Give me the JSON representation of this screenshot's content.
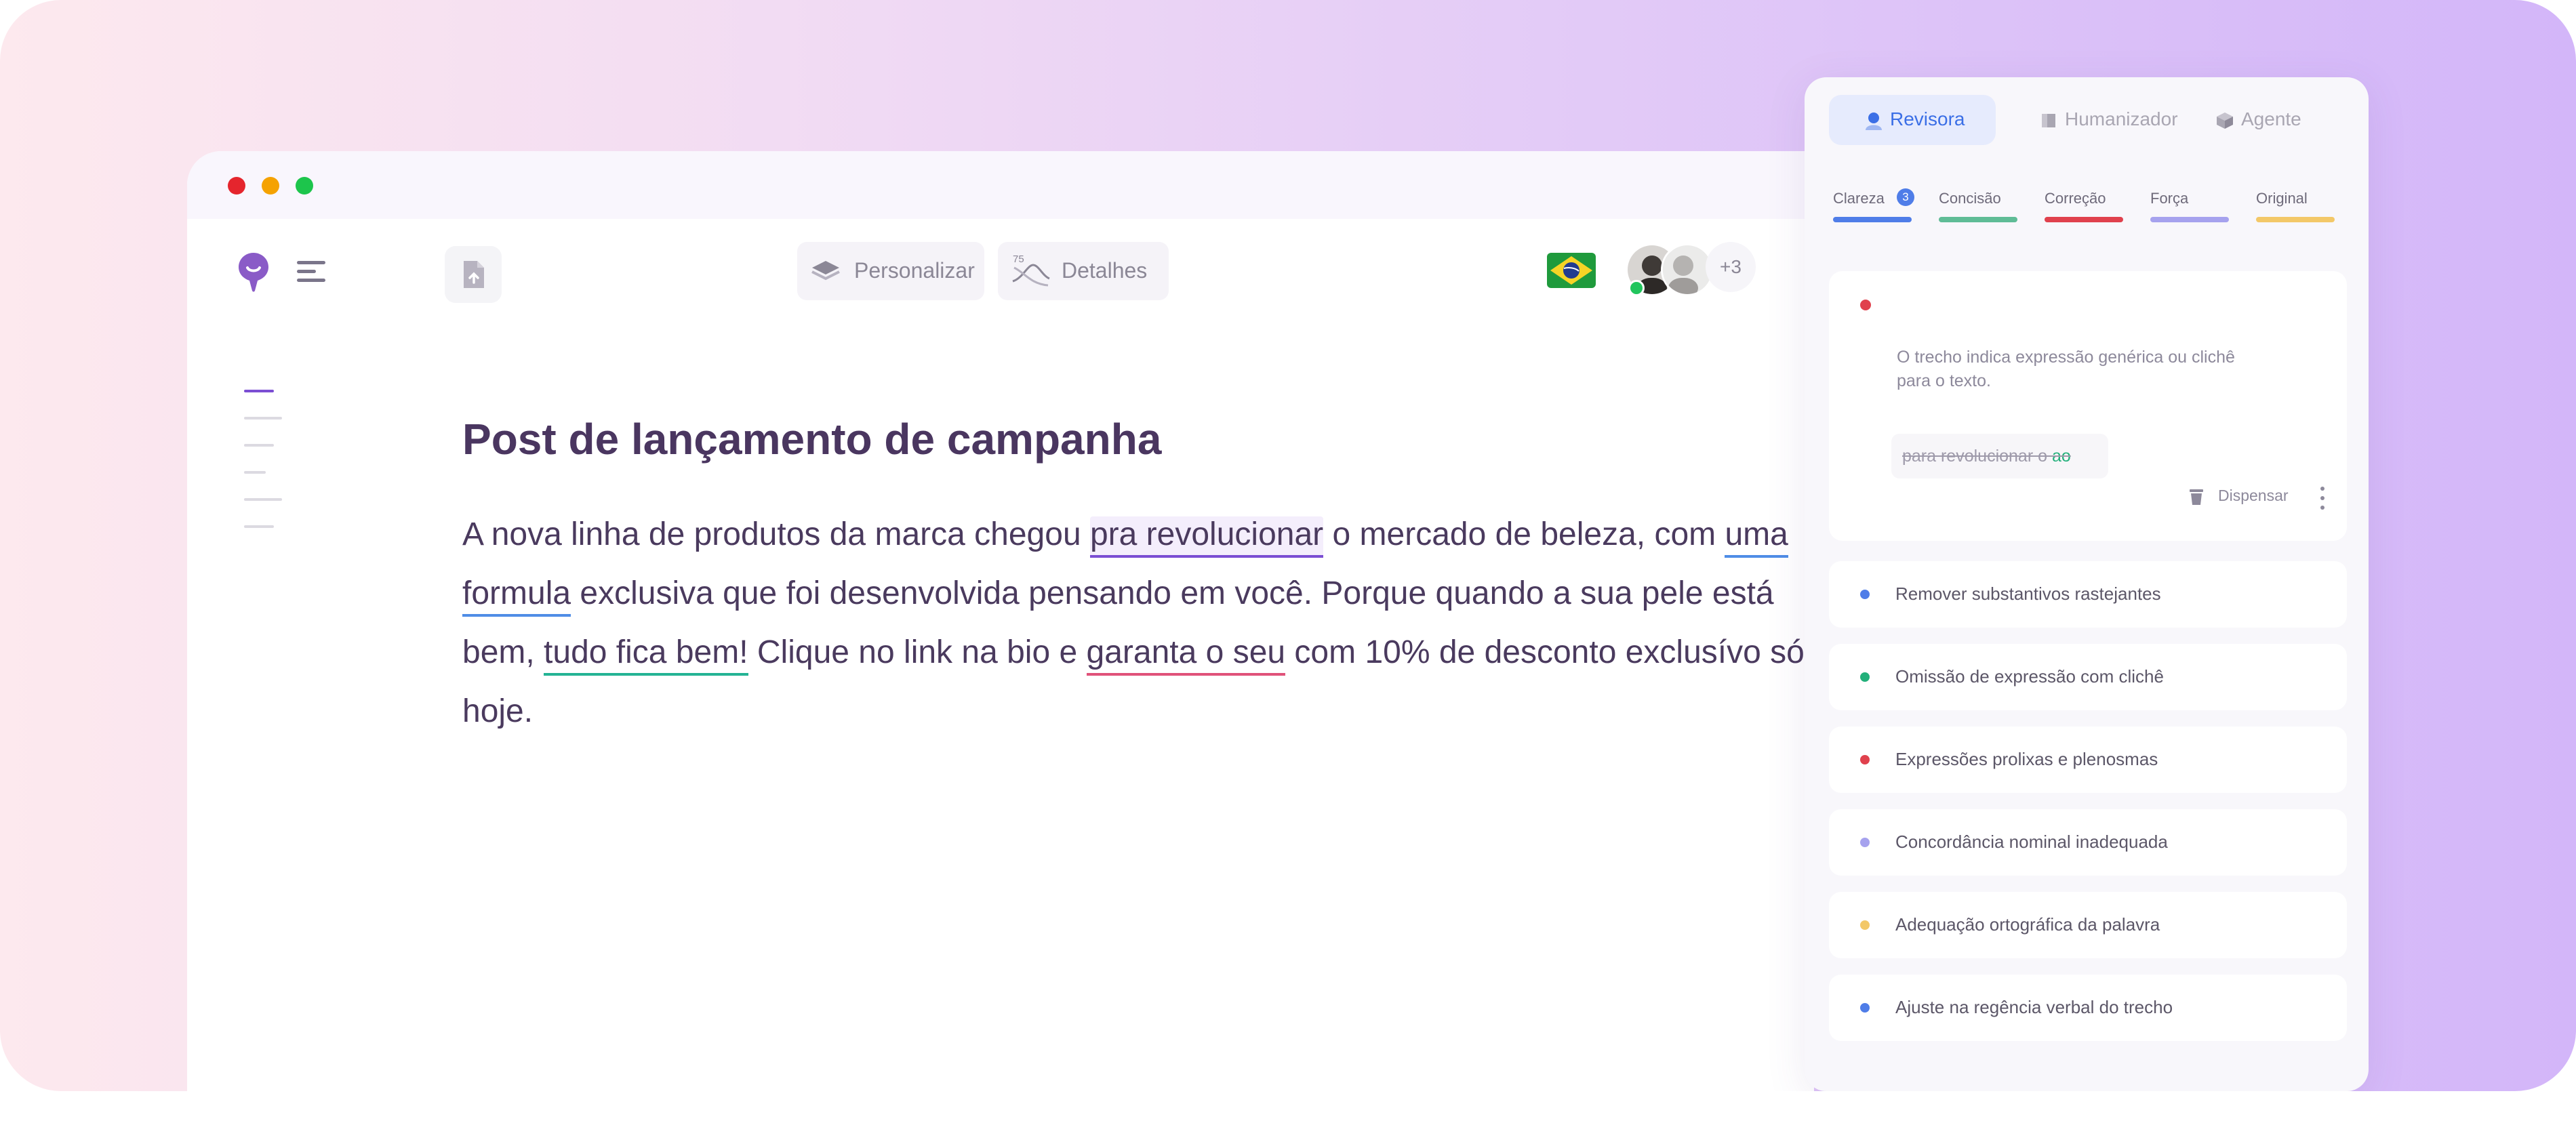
{
  "window": {
    "title_dots": [
      "close",
      "minimize",
      "maximize"
    ]
  },
  "toolbar": {
    "logo_icon": "speech-bubble-logo",
    "menu_icon": "menu-icon",
    "doc_icon": "document-upload-icon",
    "personalize_label": "Personalizar",
    "details_badge": "75",
    "details_label": "Detalhes",
    "language_flag": "Brazil",
    "extra_users_label": "+3"
  },
  "document": {
    "title": "Post de lançamento de campanha",
    "body": {
      "p1": "A nova linha de produtos da marca chegou ",
      "h1": "pra revolucionar",
      "p2": " o mercado de beleza, com ",
      "h2": "uma formula",
      "p3": " exclusiva que foi desenvolvida pensando em você. Porque quando a sua pele está bem, ",
      "h3": "tudo fica bem!",
      "p4": " Clique no link na bio e ",
      "h4": "garanta o seu",
      "p5": " com 10% de desconto exclusívo só hoje."
    }
  },
  "panel": {
    "tabs": [
      {
        "label": "Revisora",
        "icon": "person-icon",
        "active": true
      },
      {
        "label": "Humanizador",
        "icon": "head-icon",
        "active": false
      },
      {
        "label": "Agente",
        "icon": "cube-icon",
        "active": false
      }
    ],
    "categories": [
      {
        "label": "Clareza",
        "color": "#4f7de8",
        "count": "3"
      },
      {
        "label": "Concisão",
        "color": "#5fbc96"
      },
      {
        "label": "Correção",
        "color": "#e0414d"
      },
      {
        "label": "Força",
        "color": "#a6a2ee"
      },
      {
        "label": "Original",
        "color": "#f3c868"
      }
    ],
    "suggestion": {
      "dot_color": "#e0414d",
      "description": "O trecho indica expressão genérica ou clichê para o texto.",
      "original_text": "para revolucionar o",
      "replacement_text": "ao",
      "dismiss_label": "Dispensar"
    },
    "issues": [
      {
        "label": "Remover substantivos rastejantes",
        "color": "#4f7de8"
      },
      {
        "label": "Omissão de expressão com clichê",
        "color": "#22b07a"
      },
      {
        "label": "Expressões prolixas e plenosmas",
        "color": "#e0414d"
      },
      {
        "label": "Concordância nominal inadequada",
        "color": "#a6a2ee"
      },
      {
        "label": "Adequação ortográfica da palavra",
        "color": "#f3c868"
      },
      {
        "label": "Ajuste na regência verbal do trecho",
        "color": "#4f7de8"
      }
    ]
  }
}
